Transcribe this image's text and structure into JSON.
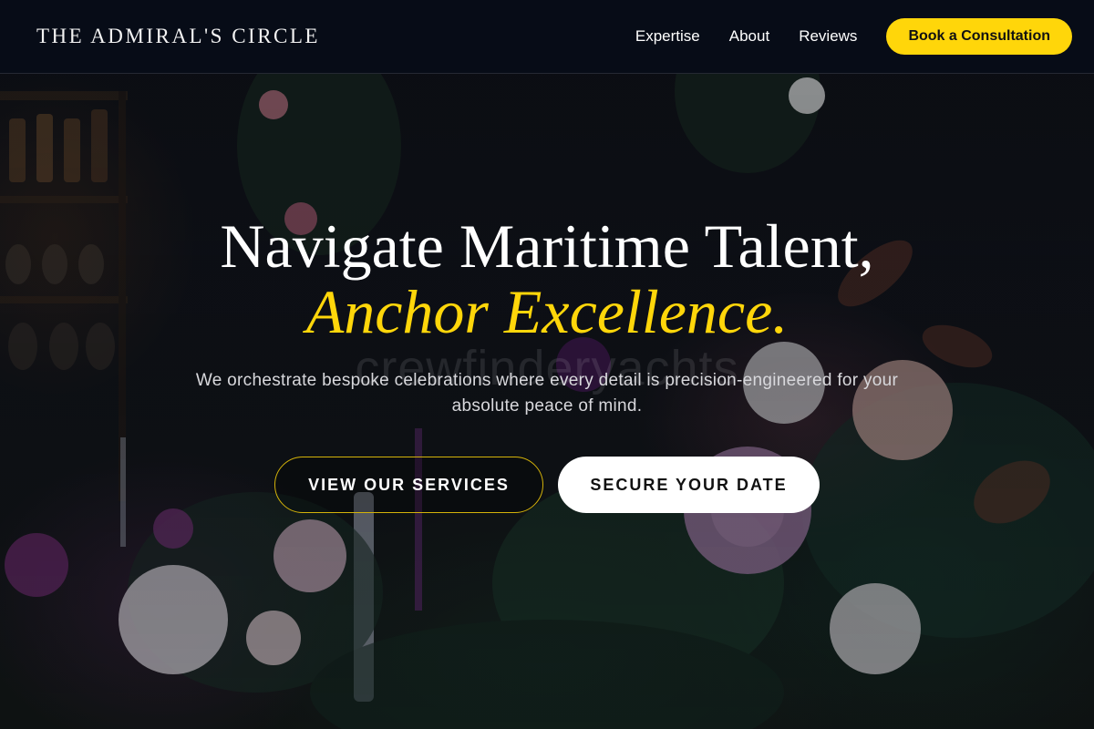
{
  "header": {
    "brand": "THE ADMIRAL'S CIRCLE",
    "nav": [
      {
        "label": "Expertise"
      },
      {
        "label": "About"
      },
      {
        "label": "Reviews"
      }
    ],
    "cta_label": "Book a Consultation"
  },
  "hero": {
    "headline_line1": "Navigate Maritime Talent,",
    "headline_line2": "Anchor Excellence.",
    "watermark": "crewfinderyachts",
    "subtitle": "We orchestrate bespoke celebrations where every detail is precision-engineered for your absolute peace of mind.",
    "primary_button": "VIEW OUR SERVICES",
    "secondary_button": "SECURE YOUR DATE",
    "background_image": "dark-floral-table-arrangement-with-candles"
  },
  "colors": {
    "accent": "#ffd60a",
    "header_bg": "#070c17",
    "text": "#ffffff"
  }
}
